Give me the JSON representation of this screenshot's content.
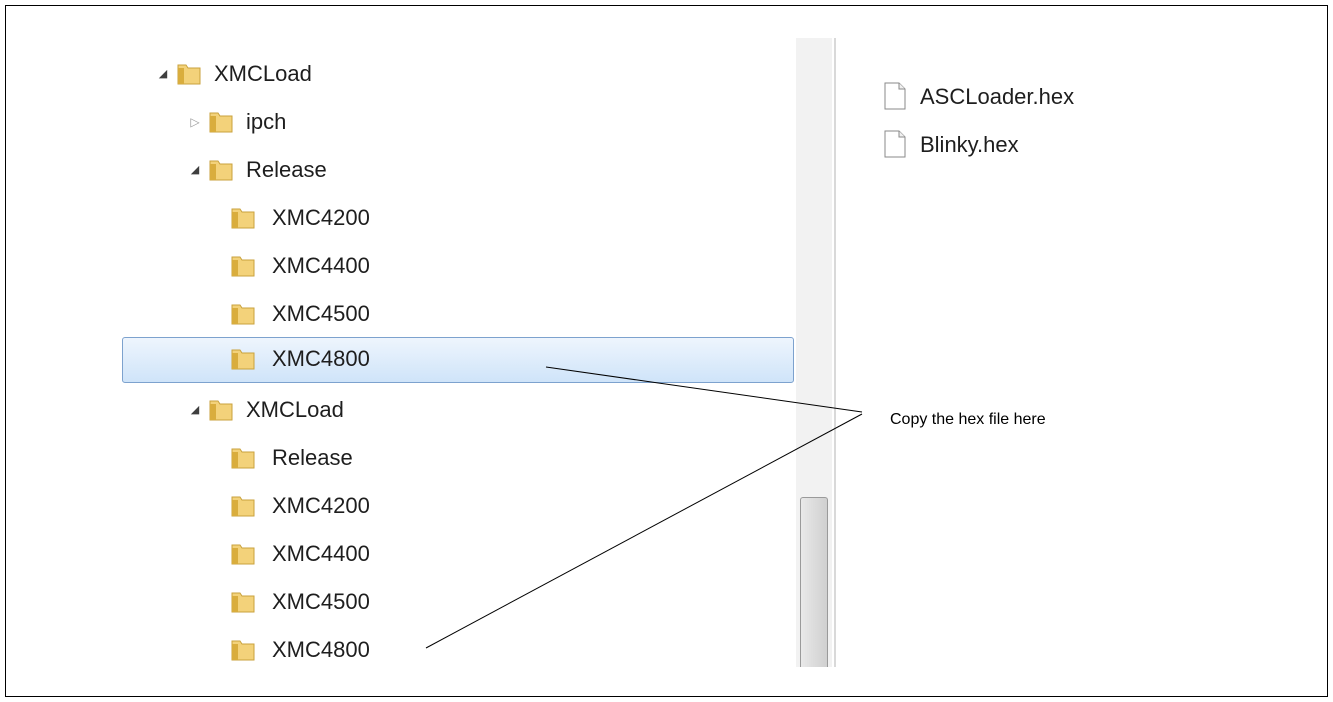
{
  "tree": {
    "items": [
      {
        "label": "XMCLoad",
        "expander": "expanded"
      },
      {
        "label": "ipch",
        "expander": "collapsed"
      },
      {
        "label": "Release",
        "expander": "expanded"
      },
      {
        "label": "XMC4200",
        "expander": "none"
      },
      {
        "label": "XMC4400",
        "expander": "none"
      },
      {
        "label": "XMC4500",
        "expander": "none"
      },
      {
        "label": "XMC4800",
        "expander": "none",
        "selected": true
      },
      {
        "label": "XMCLoad",
        "expander": "expanded"
      },
      {
        "label": "Release",
        "expander": "none"
      },
      {
        "label": "XMC4200",
        "expander": "none"
      },
      {
        "label": "XMC4400",
        "expander": "none"
      },
      {
        "label": "XMC4500",
        "expander": "none"
      },
      {
        "label": "XMC4800",
        "expander": "none"
      }
    ]
  },
  "files": {
    "items": [
      {
        "name": "ASCLoader.hex",
        "icon": "document-icon"
      },
      {
        "name": "Blinky.hex",
        "icon": "document-icon"
      }
    ]
  },
  "annotation": {
    "text": "Copy the hex file here"
  },
  "colors": {
    "folder": "#e8c25a",
    "selection_border": "#7da2ce",
    "selection_fill": "#cfe4f9"
  }
}
